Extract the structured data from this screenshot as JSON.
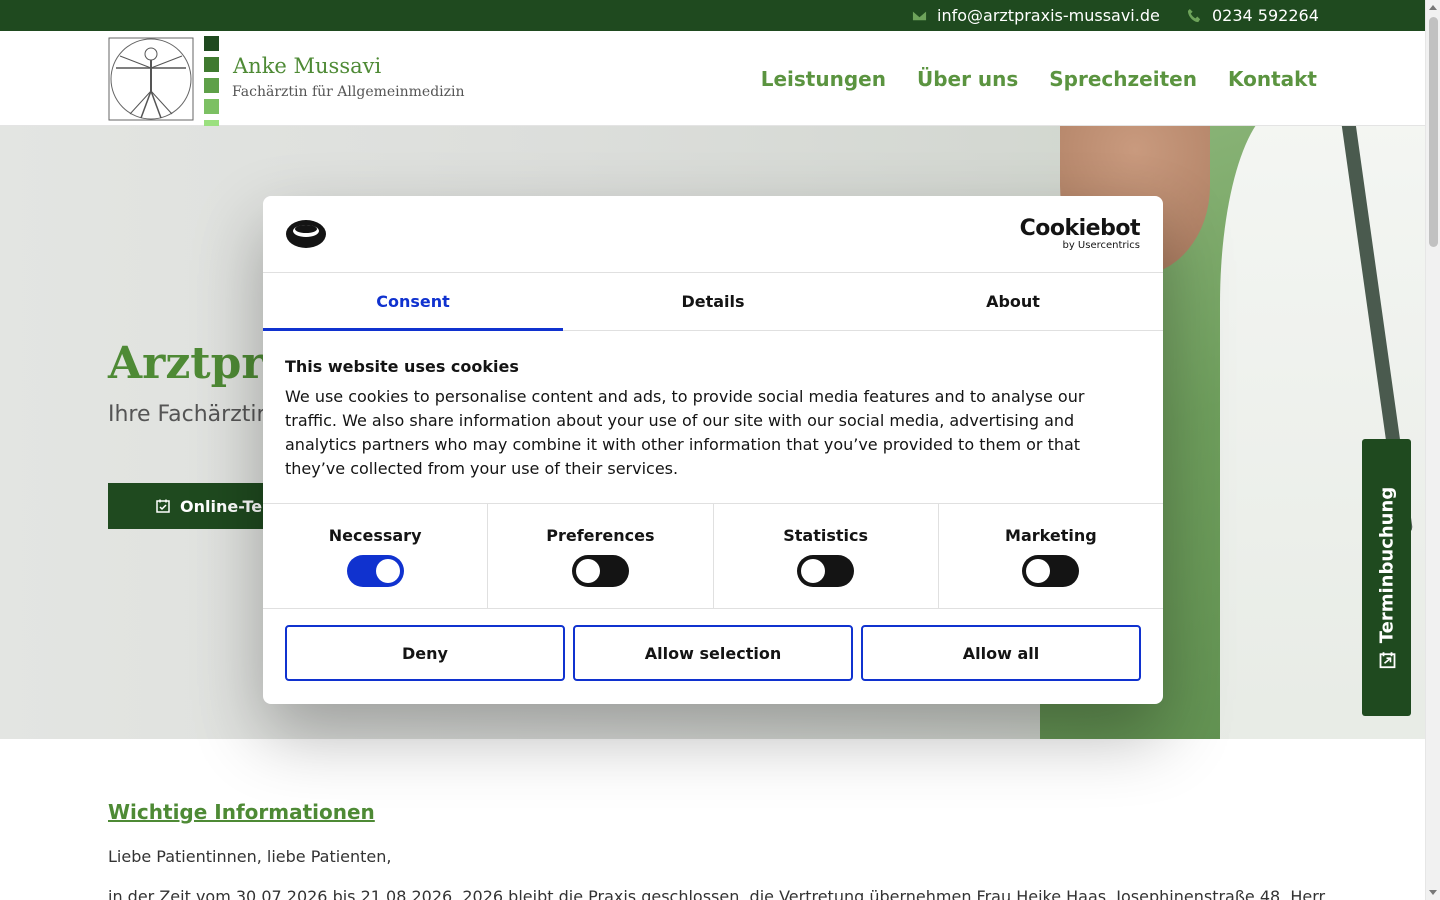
{
  "topbar": {
    "email": "info@arztpraxis-mussavi.de",
    "phone": "0234 592264"
  },
  "header": {
    "brand_name": "Anke Mussavi",
    "brand_subtitle": "Fachärztin für Allgemeinmedizin",
    "logo_square_colors": [
      "#1f4a1f",
      "#3f7a2f",
      "#5ea048",
      "#7cc063",
      "#9be07f"
    ],
    "nav": [
      "Leistungen",
      "Über uns",
      "Sprechzeiten",
      "Kontakt"
    ]
  },
  "hero": {
    "title_visible": "Arztpr",
    "subtitle_visible": "Ihre Fachärztin",
    "button_label_visible": "Online-Ter"
  },
  "side_tab": {
    "label": "Terminbuchung"
  },
  "content": {
    "heading": "Wichtige Informationen",
    "greeting": "Liebe Patientinnen, liebe Patienten,",
    "line": "in der  Zeit vom 30.07.2026 bis 21.08.2026, 2026 bleibt die Praxis geschlossen, die Vertretung übernehmen Frau Heike Haas, Josephinenstraße 48, Herr"
  },
  "cookie_dialog": {
    "brand": "Cookiebot",
    "brand_by": "by Usercentrics",
    "tabs": [
      "Consent",
      "Details",
      "About"
    ],
    "active_tab": "Consent",
    "heading": "This website uses cookies",
    "text": "We use cookies to personalise content and ads, to provide social media features and to analyse our traffic. We also share information about your use of our site with our social media, advertising and analytics partners who may combine it with other information that you’ve provided to them or that they’ve collected from your use of their services.",
    "categories": [
      {
        "label": "Necessary",
        "enabled": true
      },
      {
        "label": "Preferences",
        "enabled": false
      },
      {
        "label": "Statistics",
        "enabled": false
      },
      {
        "label": "Marketing",
        "enabled": false
      }
    ],
    "buttons": [
      "Deny",
      "Allow selection",
      "Allow all"
    ]
  },
  "colors": {
    "primary_dark_green": "#1f4a1f",
    "brand_green": "#4e8a35",
    "cookie_blue": "#1032cf"
  }
}
